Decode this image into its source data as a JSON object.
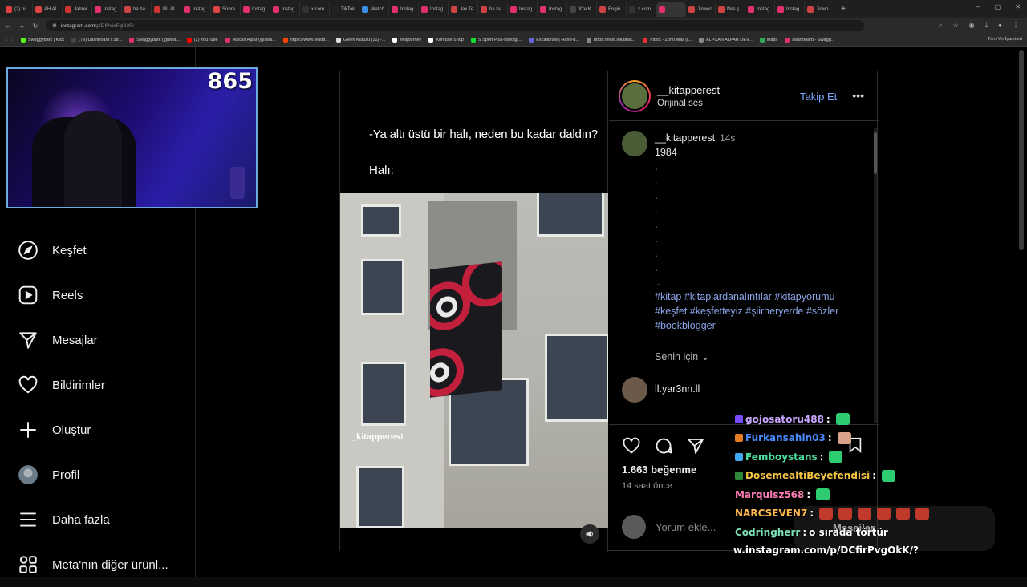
{
  "browser": {
    "tabs": [
      "(2) pi",
      "AH Al",
      "Jahrei",
      "Instag",
      "ha ha",
      "BİLAL",
      "Instag",
      "Sonra",
      "Instag",
      "Instag",
      "x.com",
      "TikTok",
      "Watch",
      "Instag",
      "Instag",
      "Jax Te",
      "ha ha",
      "Instag",
      "Instag",
      "X'te K",
      "Engin",
      "x.com",
      "",
      "Jinwoo",
      "Nes ş",
      "Instag",
      "Instag",
      "Jinwo"
    ],
    "new_tab": "+",
    "window_controls": [
      "–",
      "▢",
      "✕"
    ],
    "url_host": "instagram.com",
    "url_path": "/p/DIPxicFg9I3F/",
    "bookmarks": [
      "Swaggybark | Kick",
      "(79) Dashboard / Str...",
      "Swaggybark (@swa...",
      "(2) YouTube",
      "Alpcan Alpar (@swa...",
      "https://www.reddit...",
      "Gelen Kutusu (31) -...",
      "Midjourney",
      "Konfuse Shop",
      "S Sport Plus-İstediği...",
      "Excalidraw | Hand-d...",
      "https://nest.inkamat...",
      "Inbox - Zoho Mail (l...",
      "ALPCAN ALPAR DEV...",
      "Maps",
      "Dashboard - Swagg..."
    ],
    "bookmarks_right": "Tüm Yer İşaretleri"
  },
  "webcam": {
    "counter": "865"
  },
  "sidebar": {
    "items": [
      {
        "label": "Keşfet",
        "icon": "compass-icon"
      },
      {
        "label": "Reels",
        "icon": "reels-icon"
      },
      {
        "label": "Mesajlar",
        "icon": "messages-icon"
      },
      {
        "label": "Bildirimler",
        "icon": "heart-icon"
      },
      {
        "label": "Oluştur",
        "icon": "plus-icon"
      },
      {
        "label": "Profil",
        "icon": "avatar"
      },
      {
        "label": "Daha fazla",
        "icon": "hamburger-icon"
      },
      {
        "label": "Meta'nın diğer ürünl...",
        "icon": "meta-apps-icon"
      }
    ]
  },
  "post": {
    "caption_line1": "-Ya altı üstü bir halı, neden bu kadar daldın?",
    "caption_line2": "Halı:",
    "watermark": "_kitapperest",
    "header": {
      "username": "__kitapperest",
      "audio": "Orijinal ses",
      "follow": "Takip Et"
    },
    "caption": {
      "username": "__kitapperest",
      "time": "14s",
      "text": "1984",
      "dots": [
        ".",
        ".",
        ".",
        ".",
        ".",
        ".",
        ".",
        ".",
        ".."
      ],
      "hashtags": "#kitap #kitaplardanalıntılar #kitapyorumu #keşfet #keşfetteyiz #şiirheryerde #sözler #bookblogger"
    },
    "for_you": "Senin için",
    "comment_user": "ll.yar3nn.ll",
    "likes": "1.663 beğenme",
    "when": "14 saat önce",
    "comment_placeholder": "Yorum ekle..."
  },
  "chat": {
    "messages": [
      {
        "user": "gojosatoru488",
        "color": "#c9a6ff",
        "msg": ""
      },
      {
        "user": "Furkansahin03",
        "color": "#4a8cff",
        "msg": ""
      },
      {
        "user": "Femboystans",
        "color": "#4be0a0",
        "msg": ""
      },
      {
        "user": "DosemealtiBeyefendisi",
        "color": "#f5c542",
        "msg": ""
      },
      {
        "user": "Marquisz568",
        "color": "#ff7eb6",
        "msg": ""
      },
      {
        "user": "NARCSEVEN7",
        "color": "#ffb74d",
        "msg": ""
      },
      {
        "user": "Codringherr",
        "color": "#7ee0b5",
        "msg": "o sırada törtür"
      }
    ],
    "url": "w.instagram.com/p/DCfirPvgOkK/?",
    "overlay_label": "Mesajlar"
  },
  "colors": {
    "accent_link": "#7aa9ff",
    "hashtag": "#8aa5e8",
    "webcam_border": "#6fa8dc"
  }
}
